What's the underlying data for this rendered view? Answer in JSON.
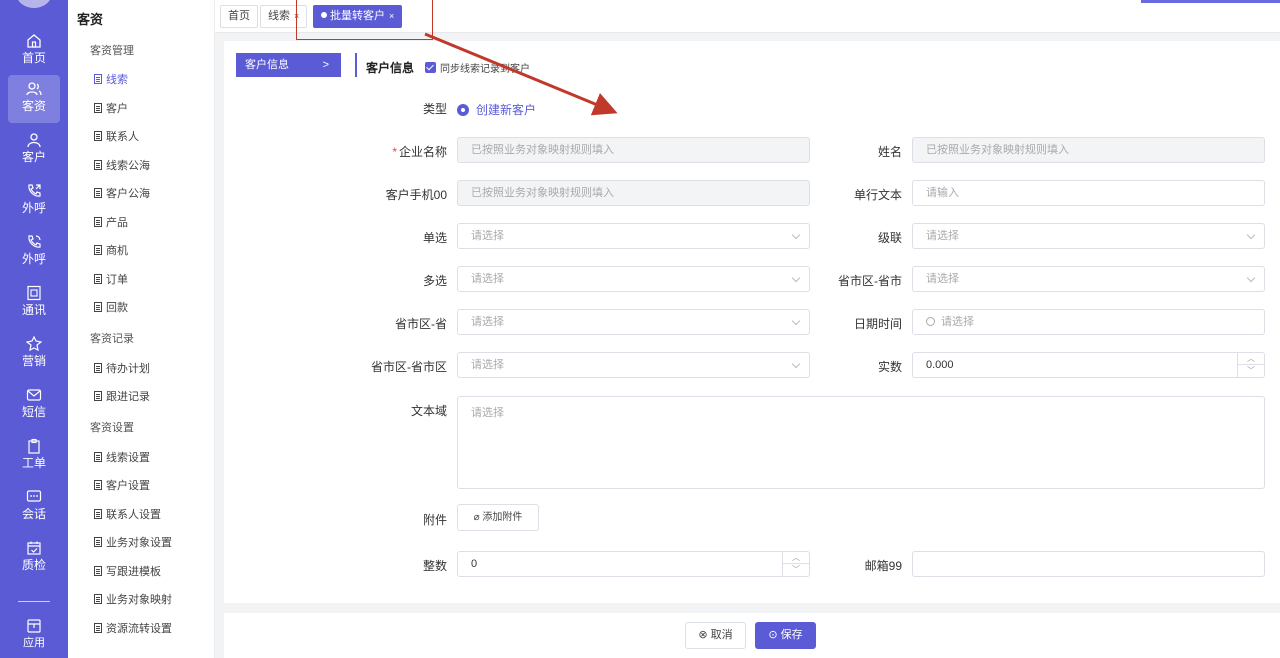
{
  "rail": {
    "items": [
      {
        "label": "首页",
        "icon": "home-icon"
      },
      {
        "label": "客资",
        "icon": "users-icon"
      },
      {
        "label": "客户",
        "icon": "user-icon"
      },
      {
        "label": "外呼",
        "icon": "phone-out-icon"
      },
      {
        "label": "外呼",
        "icon": "phone-call-icon"
      },
      {
        "label": "通讯",
        "icon": "contacts-icon"
      },
      {
        "label": "营销",
        "icon": "marketing-icon"
      },
      {
        "label": "短信",
        "icon": "sms-icon"
      },
      {
        "label": "工单",
        "icon": "clipboard-icon"
      },
      {
        "label": "会话",
        "icon": "chat-icon"
      },
      {
        "label": "质检",
        "icon": "calendar-check-icon"
      },
      {
        "label": "应用",
        "icon": "apps-icon"
      }
    ]
  },
  "submenu": {
    "title": "客资",
    "groups": [
      {
        "title": "客资管理",
        "items": [
          "线索",
          "客户",
          "联系人",
          "线索公海",
          "客户公海",
          "产品",
          "商机",
          "订单",
          "回款"
        ]
      },
      {
        "title": "客资记录",
        "items": [
          "待办计划",
          "跟进记录"
        ]
      },
      {
        "title": "客资设置",
        "items": [
          "线索设置",
          "客户设置",
          "联系人设置",
          "业务对象设置",
          "写跟进模板",
          "业务对象映射",
          "资源流转设置"
        ]
      }
    ]
  },
  "tabs": [
    {
      "label": "首页"
    },
    {
      "label": "线索"
    },
    {
      "label": "批量转客户"
    }
  ],
  "form": {
    "side_tab": "客户信息",
    "header_title": "客户信息",
    "sync_label": "同步线索记录到客户",
    "type_label": "类型",
    "type_value": "创建新客户",
    "fields": {
      "company_name": {
        "label": "企业名称",
        "placeholder": "已按照业务对象映射规则填入"
      },
      "name": {
        "label": "姓名",
        "placeholder": "已按照业务对象映射规则填入"
      },
      "phone": {
        "label": "客户手机00",
        "placeholder": "已按照业务对象映射规则填入"
      },
      "single_text": {
        "label": "单行文本",
        "placeholder": "请输入"
      },
      "single_select": {
        "label": "单选",
        "placeholder": "请选择"
      },
      "cascade": {
        "label": "级联",
        "placeholder": "请选择"
      },
      "multi_select": {
        "label": "多选",
        "placeholder": "请选择"
      },
      "province_city": {
        "label": "省市区-省市",
        "placeholder": "请选择"
      },
      "province": {
        "label": "省市区-省",
        "placeholder": "请选择"
      },
      "datetime": {
        "label": "日期时间",
        "placeholder": "请选择"
      },
      "province_city_district": {
        "label": "省市区-省市区",
        "placeholder": "请选择"
      },
      "real_number": {
        "label": "实数",
        "value": "0.000"
      },
      "textarea": {
        "label": "文本域",
        "placeholder": "请选择"
      },
      "attachment": {
        "label": "附件",
        "button": "添加附件"
      },
      "integer": {
        "label": "整数",
        "value": "0"
      },
      "email": {
        "label": "邮箱99",
        "value": ""
      }
    }
  },
  "footer": {
    "cancel": "取消",
    "save": "保存"
  },
  "colors": {
    "primary": "#5b5bd6",
    "annotation": "#c0392b",
    "required": "#e54545"
  }
}
